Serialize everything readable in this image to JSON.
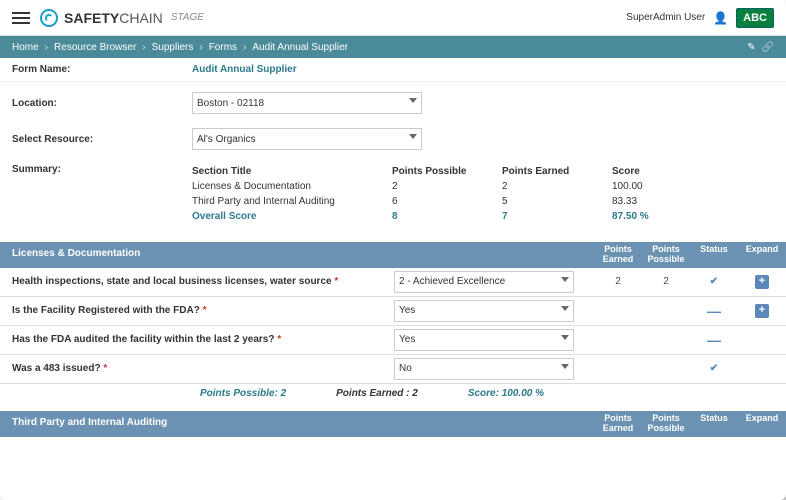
{
  "header": {
    "brand_bold": "SAFETY",
    "brand_light": "CHAIN",
    "stage": "STAGE",
    "user": "SuperAdmin User",
    "company": "ABC"
  },
  "breadcrumb": [
    "Home",
    "Resource Browser",
    "Suppliers",
    "Forms",
    "Audit Annual Supplier"
  ],
  "form": {
    "name_label": "Form Name:",
    "name_value": "Audit Annual Supplier",
    "location_label": "Location:",
    "location_value": "Boston - 02118",
    "resource_label": "Select Resource:",
    "resource_value": "Al's Organics",
    "summary_label": "Summary:"
  },
  "summary": {
    "headers": [
      "Section Title",
      "Points Possible",
      "Points Earned",
      "Score"
    ],
    "rows": [
      {
        "title": "Licenses & Documentation",
        "possible": "2",
        "earned": "2",
        "score": "100.00"
      },
      {
        "title": "Third Party and Internal Auditing",
        "possible": "6",
        "earned": "5",
        "score": "83.33"
      }
    ],
    "overall": {
      "title": "Overall Score",
      "possible": "8",
      "earned": "7",
      "score": "87.50 %"
    }
  },
  "section1": {
    "title": "Licenses & Documentation",
    "cols": [
      "Points Earned",
      "Points Possible",
      "Status",
      "Expand"
    ],
    "q1": {
      "text": "Health inspections, state and local business licenses, water source",
      "value": "2 - Achieved Excellence",
      "earned": "2",
      "possible": "2"
    },
    "q2": {
      "text": "Is the Facility Registered with the FDA?",
      "value": "Yes"
    },
    "q3": {
      "text": "Has the FDA audited the facility within the last 2 years?",
      "value": "Yes"
    },
    "q4": {
      "text": "Was a 483 issued?",
      "value": "No"
    },
    "footer": {
      "pp": "Points Possible: 2",
      "pe": "Points Earned : 2",
      "sc": "Score: 100.00 %"
    }
  },
  "section2": {
    "title": "Third Party and Internal Auditing",
    "cols": [
      "Points Earned",
      "Points Possible",
      "Status",
      "Expand"
    ]
  }
}
